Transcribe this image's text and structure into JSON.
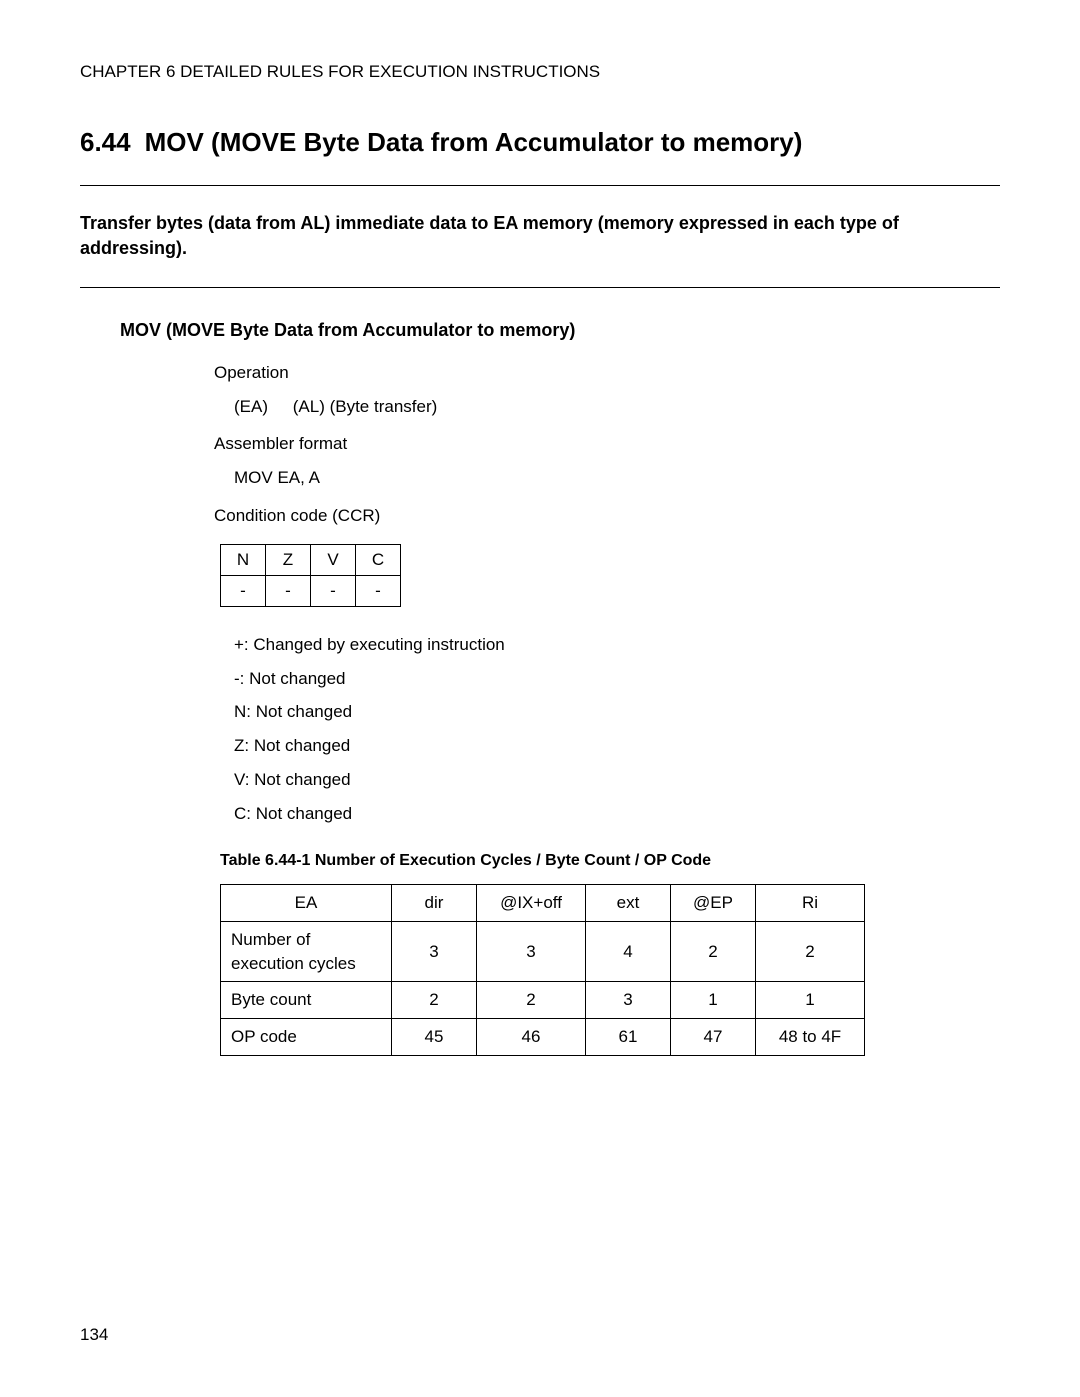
{
  "chapter_header": "CHAPTER 6  DETAILED RULES FOR EXECUTION INSTRUCTIONS",
  "section_number": "6.44",
  "section_title": "MOV (MOVE Byte Data from Accumulator to memory)",
  "summary": "Transfer bytes (data from AL) immediate data to EA memory (memory expressed in each type of addressing).",
  "subheading": "MOV (MOVE Byte Data from Accumulator to memory)",
  "labels": {
    "operation": "Operation",
    "assembler_format": "Assembler format",
    "condition_code": "Condition code (CCR)"
  },
  "operation_line": {
    "lhs": "(EA)",
    "rhs": "(AL) (Byte transfer)"
  },
  "assembler_line": "MOV EA, A",
  "ccr": {
    "headers": [
      "N",
      "Z",
      "V",
      "C"
    ],
    "values": [
      "-",
      "-",
      "-",
      "-"
    ]
  },
  "legend": [
    "+: Changed by executing instruction",
    "-: Not changed",
    "N: Not changed",
    "Z: Not changed",
    "V: Not changed",
    "C: Not changed"
  ],
  "table_caption": "Table 6.44-1  Number of Execution Cycles / Byte Count / OP Code",
  "exec_table": {
    "columns": [
      "EA",
      "dir",
      "@IX+off",
      "ext",
      "@EP",
      "Ri"
    ],
    "rows": [
      {
        "label": "Number of execution cycles",
        "values": [
          "3",
          "3",
          "4",
          "2",
          "2"
        ]
      },
      {
        "label": "Byte count",
        "values": [
          "2",
          "2",
          "3",
          "1",
          "1"
        ]
      },
      {
        "label": "OP code",
        "values": [
          "45",
          "46",
          "61",
          "47",
          "48 to 4F"
        ]
      }
    ]
  },
  "page_number": "134"
}
